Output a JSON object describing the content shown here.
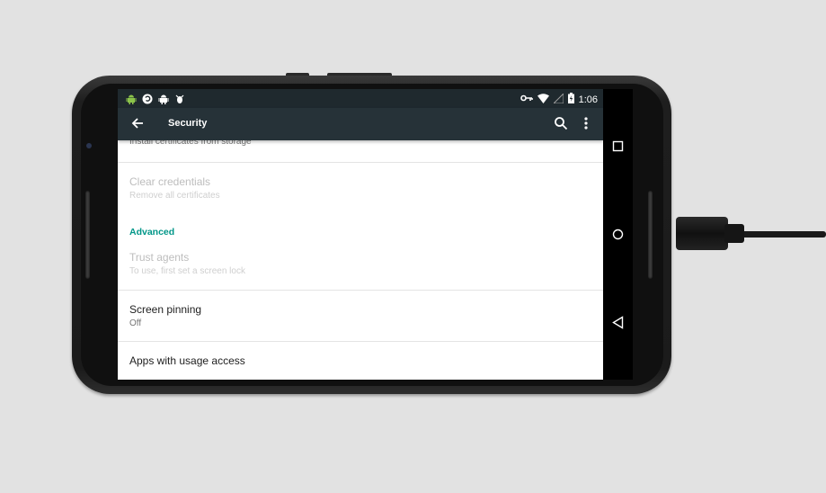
{
  "status_bar": {
    "time": "1:06",
    "left_icons": [
      "android-icon",
      "sync-icon",
      "android-icon",
      "debug-icon"
    ],
    "right_icons": [
      "vpn-key-icon",
      "wifi-icon",
      "signal-icon",
      "battery-charging-icon"
    ]
  },
  "app_bar": {
    "title": "Security",
    "back_icon": "arrow-back-icon",
    "search_icon": "search-icon",
    "more_icon": "more-vert-icon"
  },
  "list": {
    "install_certs_summary": "Install certificates from storage",
    "clear_credentials": {
      "title": "Clear credentials",
      "summary": "Remove all certificates"
    },
    "advanced_header": "Advanced",
    "trust_agents": {
      "title": "Trust agents",
      "summary": "To use, first set a screen lock"
    },
    "screen_pinning": {
      "title": "Screen pinning",
      "summary": "Off"
    },
    "usage_access": {
      "title": "Apps with usage access"
    }
  },
  "nav_bar": [
    "recents-icon",
    "home-icon",
    "back-icon"
  ],
  "colors": {
    "app_bar": "#263238",
    "status_bar": "#1f292e",
    "accent": "#009688"
  }
}
